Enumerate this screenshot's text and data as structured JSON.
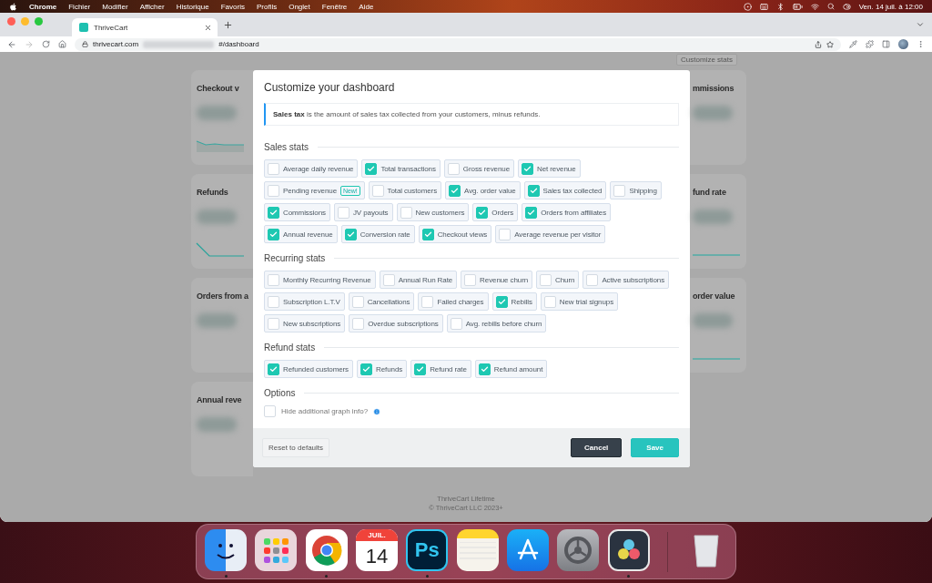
{
  "menu_bar": {
    "app_name": "Chrome",
    "menus": [
      "Fichier",
      "Modifier",
      "Afficher",
      "Historique",
      "Favoris",
      "Profils",
      "Onglet",
      "Fenêtre",
      "Aide"
    ],
    "clock": "Ven. 14 juil. à 12:00"
  },
  "browser": {
    "tabs": [
      {
        "title": "ThriveCart",
        "selected": true
      }
    ],
    "address": {
      "host": "thrivecart.com",
      "path": "#/dashboard"
    }
  },
  "page": {
    "customize_button": "Customize stats",
    "left_cards": [
      {
        "title": "Checkout v",
        "kind": "area"
      },
      {
        "title": "Refunds",
        "kind": "drop"
      },
      {
        "title": "Orders from a",
        "kind": "plain"
      },
      {
        "title": "Annual reve",
        "kind": "plain"
      }
    ],
    "right_cards": [
      {
        "title": "mmissions",
        "kind": "plain"
      },
      {
        "title": "fund rate",
        "kind": "flat"
      },
      {
        "title": "order value",
        "kind": "flat"
      }
    ],
    "footer": [
      "ThriveCart Lifetime",
      "© ThriveCart LLC 2023+"
    ]
  },
  "modal": {
    "title": "Customize your dashboard",
    "notice": "**Sales tax** is the amount of sales tax collected from your customers, minus refunds.",
    "sections": [
      {
        "title": "Sales stats",
        "rows": [
          {
            "options": [
              {
                "label": "Average daily revenue",
                "checked": false
              },
              {
                "label": "Total transactions",
                "checked": true
              },
              {
                "label": "Gross revenue",
                "checked": false
              },
              {
                "label": "Net revenue",
                "checked": true
              }
            ]
          },
          {
            "options": [
              {
                "label": "Pending revenue",
                "checked": false,
                "badge": "New!"
              },
              {
                "label": "Total customers",
                "checked": false
              },
              {
                "label": "Avg. order value",
                "checked": true
              },
              {
                "label": "Sales tax collected",
                "checked": true
              },
              {
                "label": "Shipping",
                "checked": false
              }
            ]
          },
          {
            "options": [
              {
                "label": "Commissions",
                "checked": true
              },
              {
                "label": "JV payouts",
                "checked": false
              },
              {
                "label": "New customers",
                "checked": false
              },
              {
                "label": "Orders",
                "checked": true
              },
              {
                "label": "Orders from affiliates",
                "checked": true
              }
            ]
          },
          {
            "options": [
              {
                "label": "Annual revenue",
                "checked": true
              },
              {
                "label": "Conversion rate",
                "checked": true
              },
              {
                "label": "Checkout views",
                "checked": true
              },
              {
                "label": "Average revenue per visitor",
                "checked": false
              }
            ]
          }
        ]
      },
      {
        "title": "Recurring stats",
        "rows": [
          {
            "options": [
              {
                "label": "Monthly Recurring Revenue",
                "checked": false
              },
              {
                "label": "Annual Run Rate",
                "checked": false
              },
              {
                "label": "Revenue churn",
                "checked": false
              },
              {
                "label": "Churn",
                "checked": false
              },
              {
                "label": "Active subscriptions",
                "checked": false
              }
            ]
          },
          {
            "options": [
              {
                "label": "Subscription L.T.V",
                "checked": false
              },
              {
                "label": "Cancellations",
                "checked": false
              },
              {
                "label": "Failed charges",
                "checked": false
              },
              {
                "label": "Rebills",
                "checked": true
              },
              {
                "label": "New trial signups",
                "checked": false
              }
            ]
          },
          {
            "options": [
              {
                "label": "New subscriptions",
                "checked": false
              },
              {
                "label": "Overdue subscriptions",
                "checked": false
              },
              {
                "label": "Avg. rebills before churn",
                "checked": false
              }
            ]
          }
        ]
      },
      {
        "title": "Refund stats",
        "rows": [
          {
            "options": [
              {
                "label": "Refunded customers",
                "checked": true
              },
              {
                "label": "Refunds",
                "checked": true
              },
              {
                "label": "Refund rate",
                "checked": true
              },
              {
                "label": "Refund amount",
                "checked": true
              }
            ]
          }
        ]
      }
    ],
    "options": {
      "title": "Options",
      "label": "Hide additional graph info?",
      "checked": false
    },
    "buttons": {
      "reset": "Reset to defaults",
      "cancel": "Cancel",
      "save": "Save"
    }
  },
  "dock": {
    "apps": [
      {
        "kind": "finder",
        "running": true
      },
      {
        "kind": "launchpad",
        "running": false
      },
      {
        "kind": "chrome",
        "running": true
      },
      {
        "kind": "calendar",
        "running": false,
        "month": "JUIL.",
        "day": "14"
      },
      {
        "kind": "photoshop",
        "running": true,
        "label": "Ps"
      },
      {
        "kind": "notes",
        "running": false
      },
      {
        "kind": "appstore",
        "running": false
      },
      {
        "kind": "settings",
        "running": false
      },
      {
        "kind": "davinci",
        "running": true
      },
      {
        "kind": "trash",
        "running": false
      }
    ]
  }
}
